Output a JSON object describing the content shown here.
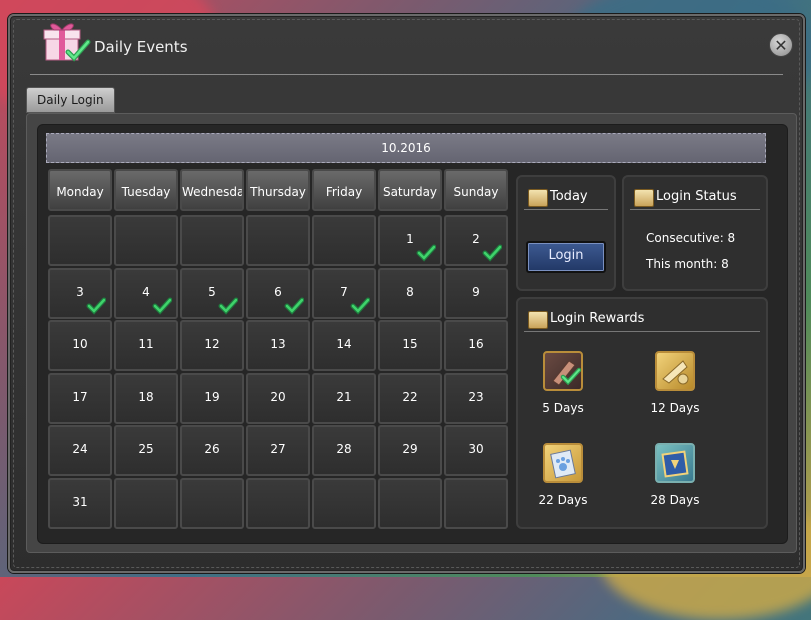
{
  "window": {
    "title": "Daily Events"
  },
  "tabs": [
    {
      "label": "Daily Login"
    }
  ],
  "calendar": {
    "month_label": "10.2016",
    "weekdays": [
      "Monday",
      "Tuesday",
      "Wednesday",
      "Thursday",
      "Friday",
      "Saturday",
      "Sunday"
    ],
    "weeks": [
      [
        {
          "day": ""
        },
        {
          "day": ""
        },
        {
          "day": ""
        },
        {
          "day": ""
        },
        {
          "day": ""
        },
        {
          "day": "1",
          "checked": true
        },
        {
          "day": "2",
          "checked": true
        }
      ],
      [
        {
          "day": "3",
          "checked": true
        },
        {
          "day": "4",
          "checked": true
        },
        {
          "day": "5",
          "checked": true
        },
        {
          "day": "6",
          "checked": true
        },
        {
          "day": "7",
          "checked": true
        },
        {
          "day": "8"
        },
        {
          "day": "9"
        }
      ],
      [
        {
          "day": "10"
        },
        {
          "day": "11"
        },
        {
          "day": "12"
        },
        {
          "day": "13"
        },
        {
          "day": "14"
        },
        {
          "day": "15"
        },
        {
          "day": "16"
        }
      ],
      [
        {
          "day": "17"
        },
        {
          "day": "18"
        },
        {
          "day": "19"
        },
        {
          "day": "20"
        },
        {
          "day": "21"
        },
        {
          "day": "22"
        },
        {
          "day": "23"
        }
      ],
      [
        {
          "day": "24"
        },
        {
          "day": "25"
        },
        {
          "day": "26"
        },
        {
          "day": "27"
        },
        {
          "day": "28"
        },
        {
          "day": "29"
        },
        {
          "day": "30"
        }
      ],
      [
        {
          "day": "31"
        },
        {
          "day": ""
        },
        {
          "day": ""
        },
        {
          "day": ""
        },
        {
          "day": ""
        },
        {
          "day": ""
        },
        {
          "day": ""
        }
      ]
    ]
  },
  "today": {
    "title": "Today",
    "button_label": "Login"
  },
  "login_status": {
    "title": "Login Status",
    "consecutive": "Consecutive: 8",
    "this_month": "This month: 8"
  },
  "rewards": {
    "title": "Login Rewards",
    "items": [
      {
        "label": "5 Days",
        "icon": "scroll-item-icon",
        "claimed": true
      },
      {
        "label": "12 Days",
        "icon": "map-item-icon",
        "claimed": false
      },
      {
        "label": "22 Days",
        "icon": "pawprint-card-icon",
        "claimed": false
      },
      {
        "label": "28 Days",
        "icon": "book-item-icon",
        "claimed": false
      }
    ]
  },
  "colors": {
    "check": "#3fd36b",
    "accent_blue": "#2c4a80",
    "gold": "#c9a35a"
  }
}
